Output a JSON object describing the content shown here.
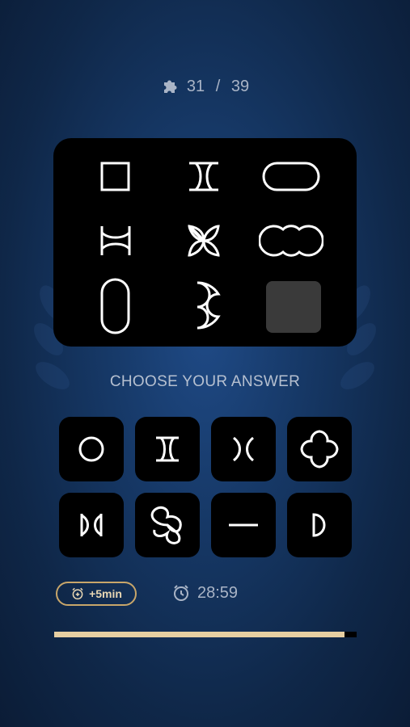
{
  "level": {
    "current": 31,
    "total": 39,
    "separator": " / ",
    "icon": "puzzle-piece-icon"
  },
  "puzzle": {
    "cells": [
      {
        "shape": "square"
      },
      {
        "shape": "hourglass-vertical"
      },
      {
        "shape": "stadium-horizontal"
      },
      {
        "shape": "hourglass-horizontal"
      },
      {
        "shape": "four-petal"
      },
      {
        "shape": "double-bite"
      },
      {
        "shape": "stadium-vertical"
      },
      {
        "shape": "bitten-circle"
      },
      {
        "shape": "missing"
      }
    ]
  },
  "prompt": "CHOOSE YOUR ANSWER",
  "options": [
    {
      "shape": "circle"
    },
    {
      "shape": "hourglass-vertical"
    },
    {
      "shape": "double-arc"
    },
    {
      "shape": "four-leaf-clover"
    },
    {
      "shape": "bowtie"
    },
    {
      "shape": "propeller"
    },
    {
      "shape": "line"
    },
    {
      "shape": "half-disc"
    }
  ],
  "bonus_button": {
    "label": "+5min",
    "icon": "alarm-plus-icon"
  },
  "timer": {
    "value": "28:59",
    "icon": "alarm-clock-icon"
  },
  "progress": {
    "fraction": 0.96
  },
  "colors": {
    "accent": "#c8a66a",
    "fill": "#e6cfa2",
    "text": "#a9b4c6",
    "tile": "#000000"
  }
}
